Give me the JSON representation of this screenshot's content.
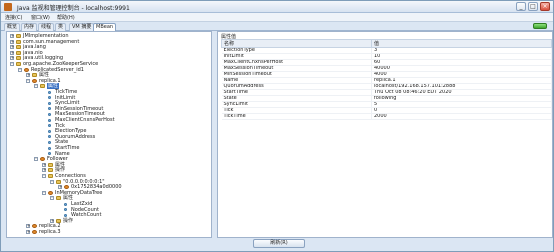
{
  "window": {
    "title": "Java 监视和管理控制台 - localhost:9991",
    "minimize_glyph": "_",
    "maximize_glyph": "□",
    "close_glyph": "×"
  },
  "menu": [
    "连接(C)",
    "窗口(W)",
    "帮助(H)"
  ],
  "tabs": [
    "概览",
    "内存",
    "线程",
    "类",
    "VM 摘要",
    "MBean"
  ],
  "active_tab": "MBean",
  "tree": [
    {
      "label": "JMImplementation",
      "depth": 0,
      "type": "folder",
      "toggle": "+"
    },
    {
      "label": "com.sun.management",
      "depth": 0,
      "type": "folder",
      "toggle": "+"
    },
    {
      "label": "java.lang",
      "depth": 0,
      "type": "folder",
      "toggle": "+"
    },
    {
      "label": "java.nio",
      "depth": 0,
      "type": "folder",
      "toggle": "+"
    },
    {
      "label": "java.util.logging",
      "depth": 0,
      "type": "folder",
      "toggle": "+"
    },
    {
      "label": "org.apache.ZooKeeperService",
      "depth": 0,
      "type": "folder",
      "toggle": "-"
    },
    {
      "label": "ReplicatedServer_id1",
      "depth": 1,
      "type": "bean",
      "toggle": "-"
    },
    {
      "label": "属性",
      "depth": 2,
      "type": "folder",
      "toggle": "+"
    },
    {
      "label": "replica.1",
      "depth": 2,
      "type": "bean",
      "toggle": "-"
    },
    {
      "label": "属性",
      "depth": 3,
      "type": "folder",
      "toggle": "-",
      "selected": true
    },
    {
      "label": "TickTime",
      "depth": 4,
      "type": "attr"
    },
    {
      "label": "InitLimit",
      "depth": 4,
      "type": "attr"
    },
    {
      "label": "SyncLimit",
      "depth": 4,
      "type": "attr"
    },
    {
      "label": "MinSessionTimeout",
      "depth": 4,
      "type": "attr"
    },
    {
      "label": "MaxSessionTimeout",
      "depth": 4,
      "type": "attr"
    },
    {
      "label": "MaxClientCnxnsPerHost",
      "depth": 4,
      "type": "attr"
    },
    {
      "label": "Tick",
      "depth": 4,
      "type": "attr"
    },
    {
      "label": "ElectionType",
      "depth": 4,
      "type": "attr"
    },
    {
      "label": "QuorumAddress",
      "depth": 4,
      "type": "attr"
    },
    {
      "label": "State",
      "depth": 4,
      "type": "attr"
    },
    {
      "label": "StartTime",
      "depth": 4,
      "type": "attr"
    },
    {
      "label": "Name",
      "depth": 4,
      "type": "attr"
    },
    {
      "label": "Follower",
      "depth": 3,
      "type": "bean",
      "toggle": "-"
    },
    {
      "label": "属性",
      "depth": 4,
      "type": "folder",
      "toggle": "+"
    },
    {
      "label": "操作",
      "depth": 4,
      "type": "folder",
      "toggle": "+"
    },
    {
      "label": "Connections",
      "depth": 4,
      "type": "folder",
      "toggle": "-"
    },
    {
      "label": "\"0.0.0.0:0:0:0:1\"",
      "depth": 5,
      "type": "folder",
      "toggle": "-"
    },
    {
      "label": "0x1752834a0d0000",
      "depth": 6,
      "type": "bean",
      "toggle": "+"
    },
    {
      "label": "InMemoryDataTree",
      "depth": 4,
      "type": "bean",
      "toggle": "-"
    },
    {
      "label": "属性",
      "depth": 5,
      "type": "folder",
      "toggle": "-"
    },
    {
      "label": "LastZxid",
      "depth": 6,
      "type": "attr"
    },
    {
      "label": "NodeCount",
      "depth": 6,
      "type": "attr"
    },
    {
      "label": "WatchCount",
      "depth": 6,
      "type": "attr"
    },
    {
      "label": "操作",
      "depth": 5,
      "type": "folder",
      "toggle": "+"
    },
    {
      "label": "replica.2",
      "depth": 2,
      "type": "bean",
      "toggle": "+"
    },
    {
      "label": "replica.3",
      "depth": 2,
      "type": "bean",
      "toggle": "+"
    }
  ],
  "properties": {
    "panel_title": "属性值",
    "header_name": "名称",
    "header_value": "值",
    "rows": [
      {
        "name": "ElectionType",
        "value": "3"
      },
      {
        "name": "InitLimit",
        "value": "10"
      },
      {
        "name": "MaxClientCnxnsPerHost",
        "value": "60"
      },
      {
        "name": "MaxSessionTimeout",
        "value": "40000"
      },
      {
        "name": "MinSessionTimeout",
        "value": "4000"
      },
      {
        "name": "Name",
        "value": "replica.1"
      },
      {
        "name": "QuorumAddress",
        "value": "localhost/192.168.157.101:2888"
      },
      {
        "name": "StartTime",
        "value": "Thu Oct 08 08:46:20 EDT 2020"
      },
      {
        "name": "State",
        "value": "following"
      },
      {
        "name": "SyncLimit",
        "value": "5"
      },
      {
        "name": "Tick",
        "value": "0"
      },
      {
        "name": "TickTime",
        "value": "2000"
      }
    ]
  },
  "refresh_label": "刷新(R)",
  "colors": {
    "selection": "#3a72c4",
    "window_bg": "#dbe6f3",
    "connected_indicator": "#3fa42e"
  }
}
